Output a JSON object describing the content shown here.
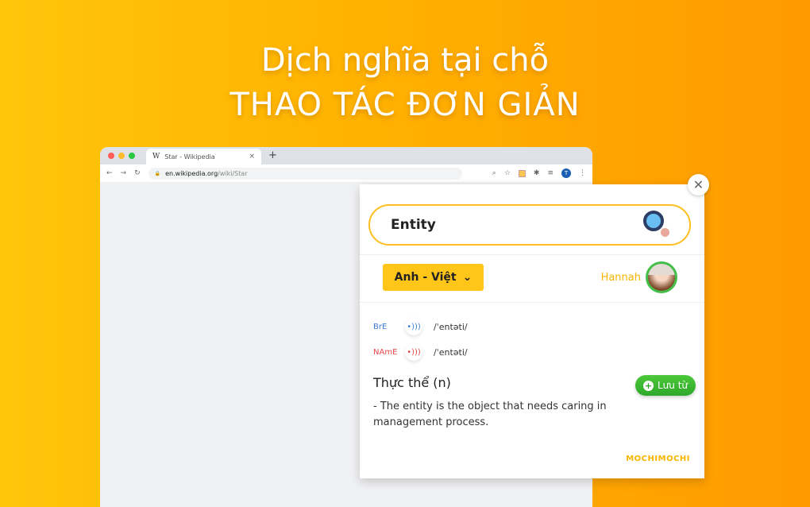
{
  "headline": {
    "line1": "Dịch nghĩa tại chỗ",
    "line2": "THAO TÁC ĐƠN GIẢN"
  },
  "browser": {
    "window_dots": [
      {
        "name": "close",
        "color": "#ff5f57"
      },
      {
        "name": "minimize",
        "color": "#febc2e"
      },
      {
        "name": "maximize",
        "color": "#28c840"
      }
    ],
    "tab": {
      "favicon": "W",
      "title": "Star - Wikipedia",
      "close": "×"
    },
    "new_tab": "+",
    "nav": {
      "back": "←",
      "forward": "→",
      "reload": "↻"
    },
    "address": {
      "lock": "🔒",
      "domain": "en.wikipedia.org",
      "path": "/wiki/Star"
    },
    "toolbar_icons": {
      "zoom": "⌕",
      "star": "☆",
      "puzzle": "✱",
      "media": "≡",
      "profile": "T",
      "menu": "⋮"
    }
  },
  "popup": {
    "close": "✕",
    "search": {
      "value": "Entity"
    },
    "language": {
      "selected": "Anh - Việt",
      "chevron": "⌄"
    },
    "user": {
      "name": "Hannah"
    },
    "pronunciations": [
      {
        "label": "BrE",
        "ipa": "/ˈentəti/",
        "color": "#3b7ddd",
        "speaker": "•)))"
      },
      {
        "label": "NAmE",
        "ipa": "/ˈentəti/",
        "color": "#e54848",
        "speaker": "•)))"
      }
    ],
    "meaning": "Thực thể (n)",
    "save_button": {
      "plus": "+",
      "label": "Lưu từ"
    },
    "definition": "- The entity is the object that needs caring in management process.",
    "brand": "MOCHIMOCHI"
  }
}
